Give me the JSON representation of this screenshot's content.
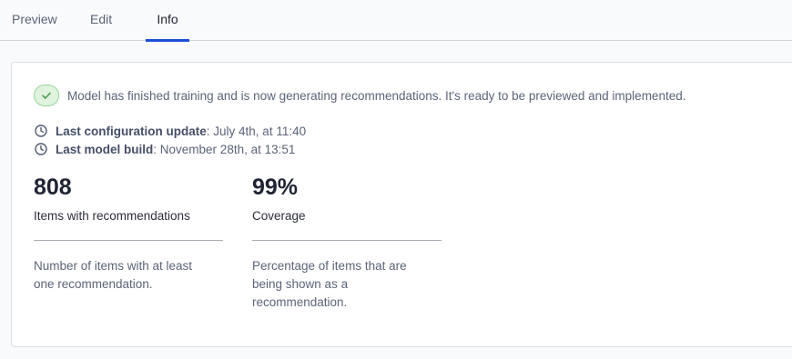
{
  "tabs": [
    {
      "label": "Preview"
    },
    {
      "label": "Edit"
    },
    {
      "label": "Info",
      "active": true
    }
  ],
  "status": {
    "message": "Model has finished training and is now generating recommendations. It's ready to be previewed and implemented.",
    "icon": "check-icon",
    "color": "#5aa55e"
  },
  "meta": {
    "last_configuration_update": {
      "label": "Last configuration update",
      "value": "July 4th, at 11:40"
    },
    "last_model_build": {
      "label": "Last model build",
      "value": "November 28th, at 13:51"
    },
    "separator": ": ",
    "icon": "clock-icon"
  },
  "stats": {
    "items": {
      "value": "808",
      "label": "Items with recommendations",
      "description": "Number of items with at least one recommendation."
    },
    "coverage": {
      "value": "99%",
      "label": "Coverage",
      "description": "Percentage of items that are being shown as a recommendation."
    }
  },
  "colors": {
    "accent": "#1d4ed8",
    "success_bg": "#dff3df",
    "success_border": "#97d49a"
  }
}
